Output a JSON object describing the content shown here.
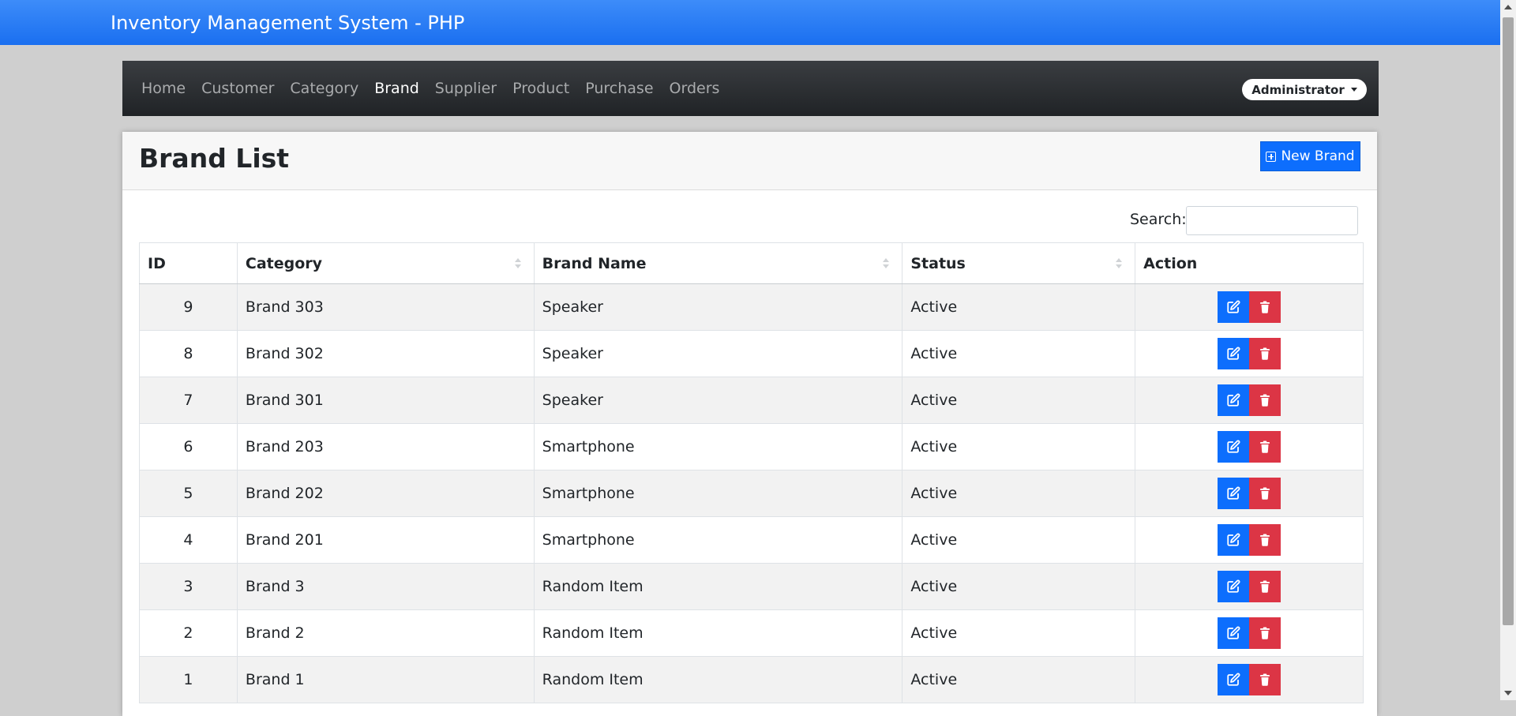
{
  "app": {
    "title": "Inventory Management System - PHP"
  },
  "nav": {
    "items": [
      {
        "label": "Home",
        "active": false
      },
      {
        "label": "Customer",
        "active": false
      },
      {
        "label": "Category",
        "active": false
      },
      {
        "label": "Brand",
        "active": true
      },
      {
        "label": "Supplier",
        "active": false
      },
      {
        "label": "Product",
        "active": false
      },
      {
        "label": "Purchase",
        "active": false
      },
      {
        "label": "Orders",
        "active": false
      }
    ],
    "user_menu": "Administrator"
  },
  "page": {
    "title": "Brand List",
    "new_button": "New Brand",
    "search_label": "Search:",
    "search_value": ""
  },
  "table": {
    "headers": [
      "ID",
      "Category",
      "Brand Name",
      "Status",
      "Action"
    ],
    "rows": [
      {
        "id": "9",
        "category": "Brand 303",
        "brand_name": "Speaker",
        "status": "Active"
      },
      {
        "id": "8",
        "category": "Brand 302",
        "brand_name": "Speaker",
        "status": "Active"
      },
      {
        "id": "7",
        "category": "Brand 301",
        "brand_name": "Speaker",
        "status": "Active"
      },
      {
        "id": "6",
        "category": "Brand 203",
        "brand_name": "Smartphone",
        "status": "Active"
      },
      {
        "id": "5",
        "category": "Brand 202",
        "brand_name": "Smartphone",
        "status": "Active"
      },
      {
        "id": "4",
        "category": "Brand 201",
        "brand_name": "Smartphone",
        "status": "Active"
      },
      {
        "id": "3",
        "category": "Brand 3",
        "brand_name": "Random Item",
        "status": "Active"
      },
      {
        "id": "2",
        "category": "Brand 2",
        "brand_name": "Random Item",
        "status": "Active"
      },
      {
        "id": "1",
        "category": "Brand 1",
        "brand_name": "Random Item",
        "status": "Active"
      }
    ]
  },
  "colors": {
    "primary": "#0d6efd",
    "danger": "#dc3545",
    "navbar": "#212529",
    "topbar": "#2a7ef5"
  },
  "icons": {
    "new": "plus-square-icon",
    "edit": "edit-icon",
    "delete": "trash-icon",
    "dropdown": "caret-down-icon"
  }
}
